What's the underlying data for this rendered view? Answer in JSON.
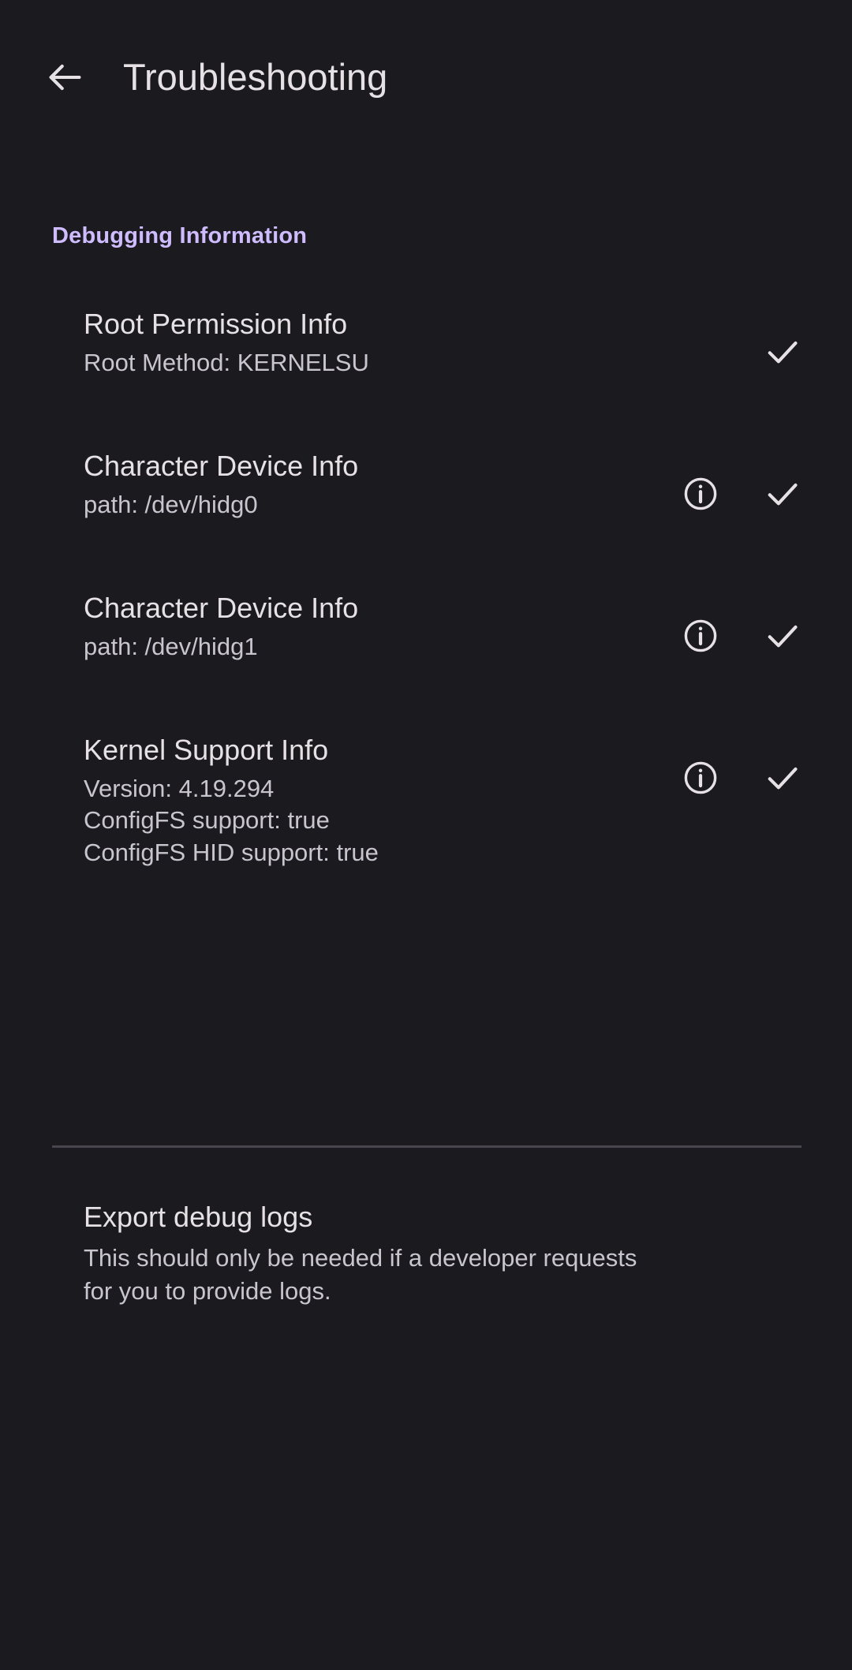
{
  "appbar": {
    "back_icon": "arrow-left-icon",
    "title": "Troubleshooting"
  },
  "section": {
    "header": "Debugging Information",
    "accent_color": "#cfbcff"
  },
  "colors": {
    "background": "#1b1a1f",
    "title_text": "#e6e1e5",
    "subtitle_text": "#c9c5ce",
    "divider": "#49454f",
    "accent": "#cfbcff"
  },
  "rows": [
    {
      "title": "Root Permission Info",
      "subtitles": [
        "Root Method: KERNELSU"
      ],
      "has_info_icon": false,
      "info_icon": "info-circle-icon",
      "status_icon": "check-icon"
    },
    {
      "title": "Character Device Info",
      "subtitles": [
        "path: /dev/hidg0"
      ],
      "has_info_icon": true,
      "info_icon": "info-circle-icon",
      "status_icon": "check-icon"
    },
    {
      "title": "Character Device Info",
      "subtitles": [
        "path: /dev/hidg1"
      ],
      "has_info_icon": true,
      "info_icon": "info-circle-icon",
      "status_icon": "check-icon"
    },
    {
      "title": "Kernel Support Info",
      "subtitles": [
        "Version: 4.19.294",
        "ConfigFS support: true",
        "ConfigFS HID support: true"
      ],
      "has_info_icon": true,
      "info_icon": "info-circle-icon",
      "status_icon": "check-icon"
    }
  ],
  "export": {
    "title": "Export debug logs",
    "description": "This should only be needed if a developer requests for you to provide logs."
  }
}
